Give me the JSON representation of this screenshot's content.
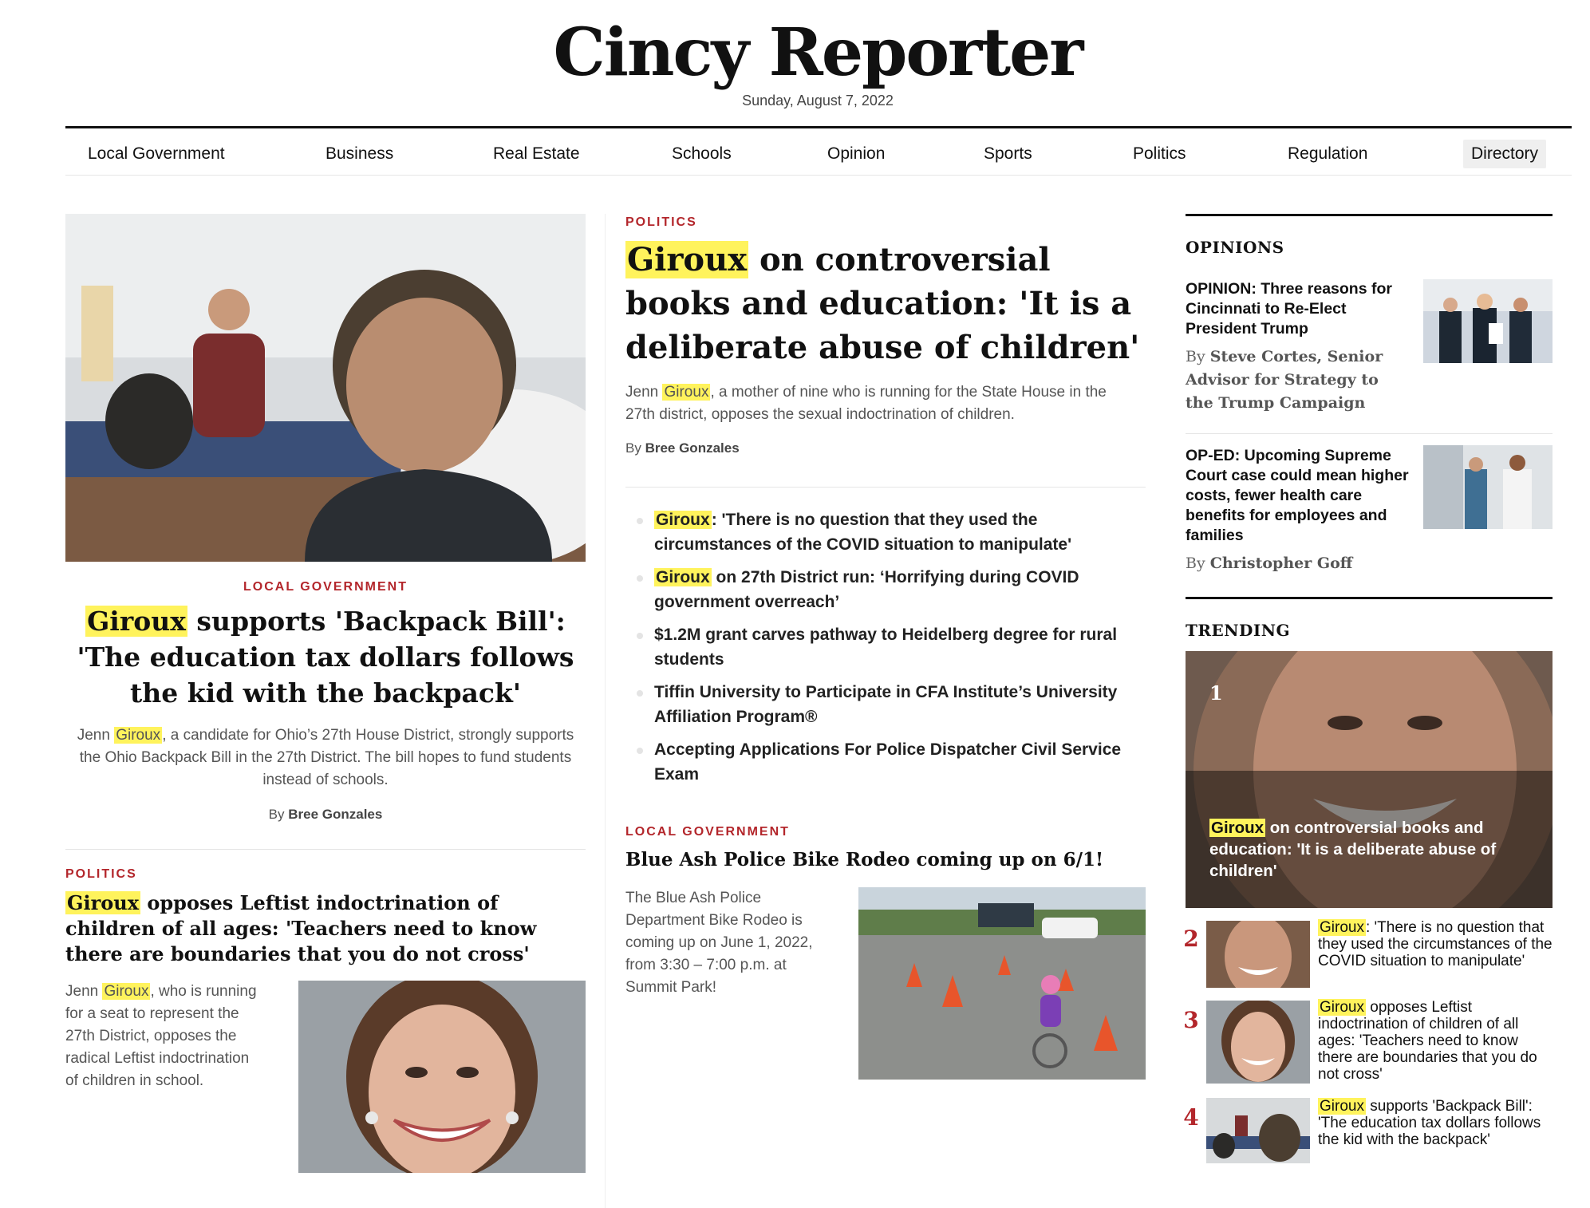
{
  "masthead": {
    "title": "Cincy Reporter",
    "date": "Sunday, August 7, 2022"
  },
  "nav": [
    {
      "label": "Local Government"
    },
    {
      "label": "Business"
    },
    {
      "label": "Real Estate"
    },
    {
      "label": "Schools"
    },
    {
      "label": "Opinion"
    },
    {
      "label": "Sports"
    },
    {
      "label": "Politics"
    },
    {
      "label": "Regulation"
    },
    {
      "label": "Directory",
      "active": true
    }
  ],
  "highlight": "Giroux",
  "lead_left": {
    "kicker": "LOCAL GOVERNMENT",
    "headline_hl": "Giroux",
    "headline_rest": " supports 'Backpack Bill': 'The education tax dollars follows the kid with the backpack'",
    "dek_pre": "Jenn ",
    "dek_hl": "Giroux",
    "dek_post": ", a candidate for Ohio’s 27th House District, strongly supports the Ohio Backpack Bill in the 27th District. The bill hopes to fund students instead of schools.",
    "by_prefix": "By ",
    "by_author": "Bree Gonzales"
  },
  "story_left_2": {
    "kicker": "POLITICS",
    "headline_hl": "Giroux",
    "headline_rest": " opposes Leftist indoctrination of children of all ages: 'Teachers need to know there are boundaries that you do not cross'",
    "dek_pre": "Jenn ",
    "dek_hl": "Giroux",
    "dek_post": ", who is running for a seat to represent the 27th District, opposes the radical Leftist indoctrination of children in school."
  },
  "main": {
    "kicker": "POLITICS",
    "headline_hl": "Giroux",
    "headline_rest": " on controversial books and education: 'It is a deliberate abuse of children'",
    "dek_pre": "Jenn ",
    "dek_hl": "Giroux",
    "dek_post": ", a mother of nine who is running for the State House in the 27th district, opposes the sexual indoctrination of children.",
    "by_prefix": "By ",
    "by_author": "Bree Gonzales",
    "related": [
      {
        "hl": "Giroux",
        "rest": ": 'There is no question that they used the circumstances of the COVID situation to manipulate'"
      },
      {
        "hl": "Giroux",
        "rest": " on 27th District run: ‘Horrifying during COVID government overreach’"
      },
      {
        "hl": "",
        "rest": "$1.2M grant carves pathway to Heidelberg degree for rural students"
      },
      {
        "hl": "",
        "rest": "Tiffin University to Participate in CFA Institute’s University Affiliation Program®"
      },
      {
        "hl": "",
        "rest": "Accepting Applications For Police Dispatcher Civil Service Exam"
      }
    ]
  },
  "story_mid_2": {
    "kicker": "LOCAL GOVERNMENT",
    "headline": "Blue Ash Police Bike Rodeo coming up on 6/1!",
    "dek": "The Blue Ash Police Department Bike Rodeo is coming up on June 1, 2022, from 3:30 – 7:00 p.m. at Summit Park!"
  },
  "opinions": {
    "title": "OPINIONS",
    "items": [
      {
        "headline": "OPINION: Three reasons for Cincinnati to Re-Elect President Trump",
        "by_prefix": "By ",
        "by_author": "Steve Cortes, Senior Advisor for Strategy to the Trump Campaign"
      },
      {
        "headline": "OP-ED: Upcoming Supreme Court case could mean higher costs, fewer health care benefits for employees and families",
        "by_prefix": "By ",
        "by_author": "Christopher Goff"
      }
    ]
  },
  "trending": {
    "title": "TRENDING",
    "hero": {
      "num": "1",
      "hl": "Giroux",
      "rest": " on controversial books and education: 'It is a deliberate abuse of children'"
    },
    "items": [
      {
        "num": "2",
        "hl": "Giroux",
        "rest": ": 'There is no question that they used the circumstances of the COVID situation to manipulate'"
      },
      {
        "num": "3",
        "hl": "Giroux",
        "rest": " opposes Leftist indoctrination of children of all ages: 'Teachers need to know there are boundaries that you do not cross'"
      },
      {
        "num": "4",
        "hl": "Giroux",
        "rest": " supports 'Backpack Bill': 'The education tax dollars follows the kid with the backpack'"
      }
    ]
  },
  "colors": {
    "accent": "#b3262b",
    "highlight": "#fff35c",
    "text": "#111111",
    "muted": "#555555"
  }
}
